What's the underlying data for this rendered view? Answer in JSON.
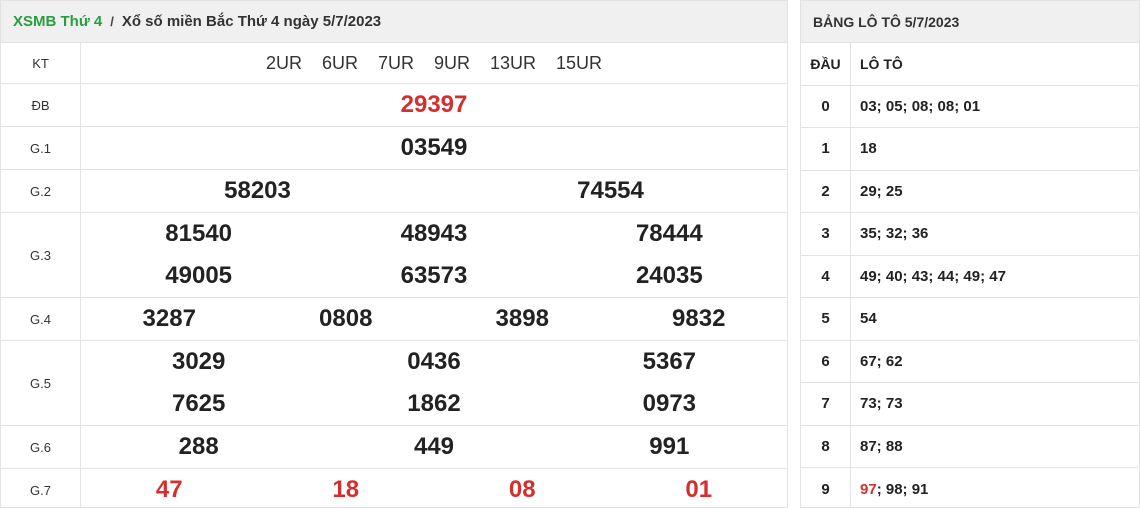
{
  "header": {
    "crumb_link": "XSMB Thứ 4",
    "separator": "/",
    "title": "Xổ số miền Bắc Thứ 4 ngày 5/7/2023"
  },
  "kt": {
    "label": "KT",
    "codes": [
      "2UR",
      "6UR",
      "7UR",
      "9UR",
      "13UR",
      "15UR"
    ]
  },
  "prizes": {
    "db": {
      "label": "ĐB",
      "value": "29397"
    },
    "g1": {
      "label": "G.1",
      "value": "03549"
    },
    "g2": {
      "label": "G.2",
      "values": [
        "58203",
        "74554"
      ]
    },
    "g3": {
      "label": "G.3",
      "values": [
        "81540",
        "48943",
        "78444",
        "49005",
        "63573",
        "24035"
      ]
    },
    "g4": {
      "label": "G.4",
      "values": [
        "3287",
        "0808",
        "3898",
        "9832"
      ]
    },
    "g5": {
      "label": "G.5",
      "values": [
        "3029",
        "0436",
        "5367",
        "7625",
        "1862",
        "0973"
      ]
    },
    "g6": {
      "label": "G.6",
      "values": [
        "288",
        "449",
        "991"
      ]
    },
    "g7": {
      "label": "G.7",
      "values": [
        "47",
        "18",
        "08",
        "01"
      ]
    }
  },
  "loto": {
    "title": "BẢNG LÔ TÔ 5/7/2023",
    "col_dau": "ĐẦU",
    "col_loto": "LÔ TÔ",
    "rows": [
      {
        "dau": "0",
        "loto": "03; 05; 08; 08; 01"
      },
      {
        "dau": "1",
        "loto": "18"
      },
      {
        "dau": "2",
        "loto": "29; 25"
      },
      {
        "dau": "3",
        "loto": "35; 32; 36"
      },
      {
        "dau": "4",
        "loto": "49; 40; 43; 44; 49; 47"
      },
      {
        "dau": "5",
        "loto": "54"
      },
      {
        "dau": "6",
        "loto": "67; 62"
      },
      {
        "dau": "7",
        "loto": "73; 73"
      },
      {
        "dau": "8",
        "loto": "87; 88"
      },
      {
        "dau": "9",
        "loto_highlight": "97",
        "loto_rest": "; 98; 91"
      }
    ]
  },
  "colors": {
    "accent_green": "#2a9d3f",
    "special_red": "#d32f2f"
  }
}
